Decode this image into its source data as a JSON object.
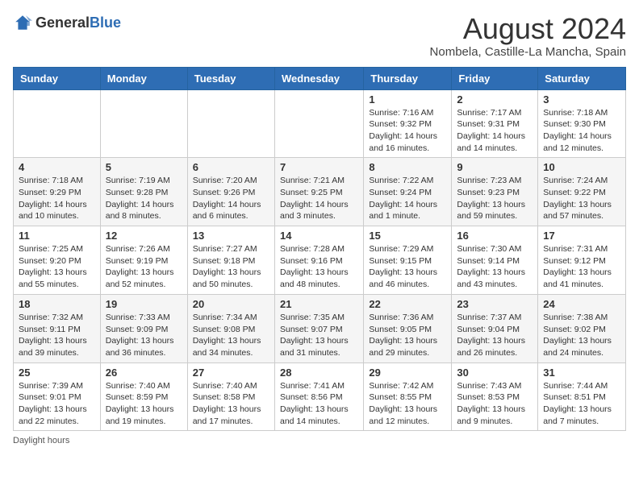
{
  "logo": {
    "general": "General",
    "blue": "Blue"
  },
  "title": "August 2024",
  "subtitle": "Nombela, Castille-La Mancha, Spain",
  "days_of_week": [
    "Sunday",
    "Monday",
    "Tuesday",
    "Wednesday",
    "Thursday",
    "Friday",
    "Saturday"
  ],
  "footer": "Daylight hours",
  "weeks": [
    [
      {
        "day": "",
        "info": ""
      },
      {
        "day": "",
        "info": ""
      },
      {
        "day": "",
        "info": ""
      },
      {
        "day": "",
        "info": ""
      },
      {
        "day": "1",
        "info": "Sunrise: 7:16 AM\nSunset: 9:32 PM\nDaylight: 14 hours and 16 minutes."
      },
      {
        "day": "2",
        "info": "Sunrise: 7:17 AM\nSunset: 9:31 PM\nDaylight: 14 hours and 14 minutes."
      },
      {
        "day": "3",
        "info": "Sunrise: 7:18 AM\nSunset: 9:30 PM\nDaylight: 14 hours and 12 minutes."
      }
    ],
    [
      {
        "day": "4",
        "info": "Sunrise: 7:18 AM\nSunset: 9:29 PM\nDaylight: 14 hours and 10 minutes."
      },
      {
        "day": "5",
        "info": "Sunrise: 7:19 AM\nSunset: 9:28 PM\nDaylight: 14 hours and 8 minutes."
      },
      {
        "day": "6",
        "info": "Sunrise: 7:20 AM\nSunset: 9:26 PM\nDaylight: 14 hours and 6 minutes."
      },
      {
        "day": "7",
        "info": "Sunrise: 7:21 AM\nSunset: 9:25 PM\nDaylight: 14 hours and 3 minutes."
      },
      {
        "day": "8",
        "info": "Sunrise: 7:22 AM\nSunset: 9:24 PM\nDaylight: 14 hours and 1 minute."
      },
      {
        "day": "9",
        "info": "Sunrise: 7:23 AM\nSunset: 9:23 PM\nDaylight: 13 hours and 59 minutes."
      },
      {
        "day": "10",
        "info": "Sunrise: 7:24 AM\nSunset: 9:22 PM\nDaylight: 13 hours and 57 minutes."
      }
    ],
    [
      {
        "day": "11",
        "info": "Sunrise: 7:25 AM\nSunset: 9:20 PM\nDaylight: 13 hours and 55 minutes."
      },
      {
        "day": "12",
        "info": "Sunrise: 7:26 AM\nSunset: 9:19 PM\nDaylight: 13 hours and 52 minutes."
      },
      {
        "day": "13",
        "info": "Sunrise: 7:27 AM\nSunset: 9:18 PM\nDaylight: 13 hours and 50 minutes."
      },
      {
        "day": "14",
        "info": "Sunrise: 7:28 AM\nSunset: 9:16 PM\nDaylight: 13 hours and 48 minutes."
      },
      {
        "day": "15",
        "info": "Sunrise: 7:29 AM\nSunset: 9:15 PM\nDaylight: 13 hours and 46 minutes."
      },
      {
        "day": "16",
        "info": "Sunrise: 7:30 AM\nSunset: 9:14 PM\nDaylight: 13 hours and 43 minutes."
      },
      {
        "day": "17",
        "info": "Sunrise: 7:31 AM\nSunset: 9:12 PM\nDaylight: 13 hours and 41 minutes."
      }
    ],
    [
      {
        "day": "18",
        "info": "Sunrise: 7:32 AM\nSunset: 9:11 PM\nDaylight: 13 hours and 39 minutes."
      },
      {
        "day": "19",
        "info": "Sunrise: 7:33 AM\nSunset: 9:09 PM\nDaylight: 13 hours and 36 minutes."
      },
      {
        "day": "20",
        "info": "Sunrise: 7:34 AM\nSunset: 9:08 PM\nDaylight: 13 hours and 34 minutes."
      },
      {
        "day": "21",
        "info": "Sunrise: 7:35 AM\nSunset: 9:07 PM\nDaylight: 13 hours and 31 minutes."
      },
      {
        "day": "22",
        "info": "Sunrise: 7:36 AM\nSunset: 9:05 PM\nDaylight: 13 hours and 29 minutes."
      },
      {
        "day": "23",
        "info": "Sunrise: 7:37 AM\nSunset: 9:04 PM\nDaylight: 13 hours and 26 minutes."
      },
      {
        "day": "24",
        "info": "Sunrise: 7:38 AM\nSunset: 9:02 PM\nDaylight: 13 hours and 24 minutes."
      }
    ],
    [
      {
        "day": "25",
        "info": "Sunrise: 7:39 AM\nSunset: 9:01 PM\nDaylight: 13 hours and 22 minutes."
      },
      {
        "day": "26",
        "info": "Sunrise: 7:40 AM\nSunset: 8:59 PM\nDaylight: 13 hours and 19 minutes."
      },
      {
        "day": "27",
        "info": "Sunrise: 7:40 AM\nSunset: 8:58 PM\nDaylight: 13 hours and 17 minutes."
      },
      {
        "day": "28",
        "info": "Sunrise: 7:41 AM\nSunset: 8:56 PM\nDaylight: 13 hours and 14 minutes."
      },
      {
        "day": "29",
        "info": "Sunrise: 7:42 AM\nSunset: 8:55 PM\nDaylight: 13 hours and 12 minutes."
      },
      {
        "day": "30",
        "info": "Sunrise: 7:43 AM\nSunset: 8:53 PM\nDaylight: 13 hours and 9 minutes."
      },
      {
        "day": "31",
        "info": "Sunrise: 7:44 AM\nSunset: 8:51 PM\nDaylight: 13 hours and 7 minutes."
      }
    ]
  ]
}
